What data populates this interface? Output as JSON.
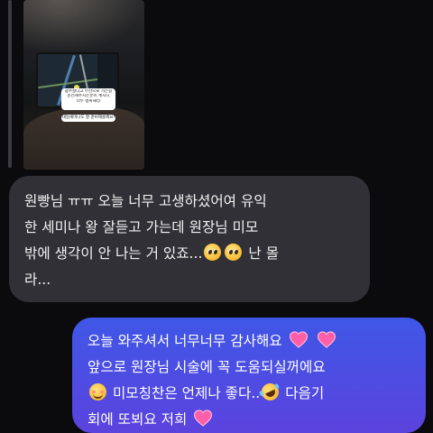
{
  "story_reply": {
    "card_text_lines": [
      "광주살다고 부산으로 가는길",
      "운전해주시는분이 계시니",
      "너무 행복해😊"
    ],
    "card_text_2": "내일세미나도 잘 준비해볼께요!"
  },
  "messages": [
    {
      "direction": "incoming",
      "lines": [
        [
          {
            "t": "text",
            "v": "원빵님 ㅠㅠ 오늘 너무 고생하셨어여 유익"
          }
        ],
        [
          {
            "t": "text",
            "v": "한 세미나 왕 잘듣고 가는데 원장님 미모"
          }
        ],
        [
          {
            "t": "text",
            "v": "밖에 생각이 안 나는 거 있죠..."
          },
          {
            "t": "emoji",
            "v": "pleading-face-icon"
          },
          {
            "t": "emoji",
            "v": "pleading-face-icon"
          },
          {
            "t": "text",
            "v": " 난 몰"
          }
        ],
        [
          {
            "t": "text",
            "v": "라..."
          }
        ]
      ]
    },
    {
      "direction": "outgoing",
      "lines": [
        [
          {
            "t": "text",
            "v": "오늘 와주셔서 너무너무 감사해요 "
          },
          {
            "t": "emoji",
            "v": "heart-icon"
          },
          {
            "t": "text",
            "v": " "
          },
          {
            "t": "emoji",
            "v": "heart-icon"
          }
        ],
        [
          {
            "t": "text",
            "v": "앞으로 원장님 시술에 꼭 도움되실꺼에요"
          }
        ],
        [
          {
            "t": "emoji",
            "v": "smiling-blush-icon"
          },
          {
            "t": "text",
            "v": "  미모칭찬은 언제나 좋다.."
          },
          {
            "t": "emoji",
            "v": "rofl-icon"
          },
          {
            "t": "text",
            "v": " 다음기"
          }
        ],
        [
          {
            "t": "text",
            "v": "회에 또뵈요 저희 "
          },
          {
            "t": "emoji",
            "v": "heart-icon"
          }
        ]
      ]
    }
  ],
  "colors": {
    "background": "#0b0b0e",
    "incoming_bubble": "#303036",
    "outgoing_bubble_top": "#3f57e6",
    "outgoing_bubble_bottom": "#5b43de",
    "heart": "#ff5fa8"
  }
}
